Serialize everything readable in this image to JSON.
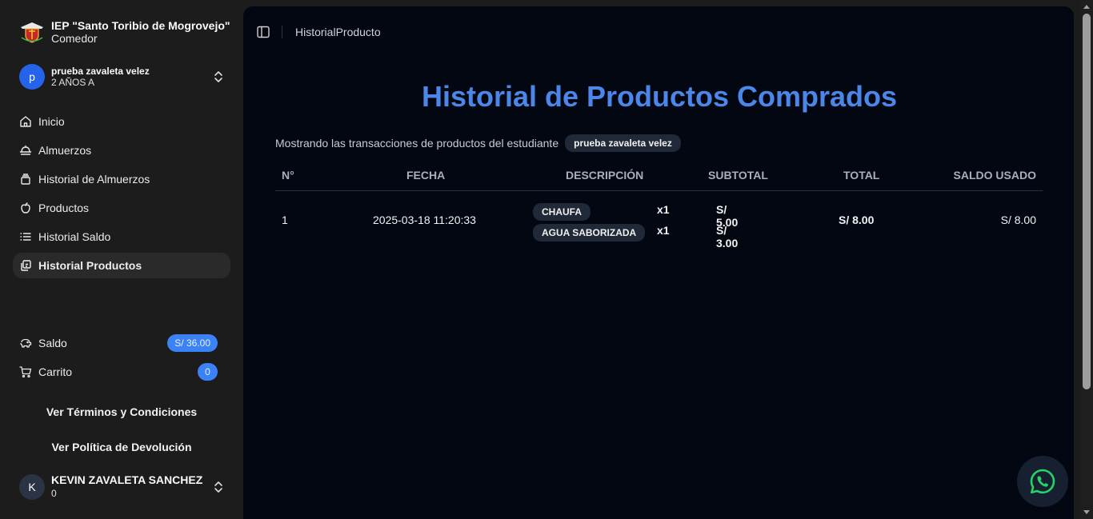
{
  "brand": {
    "title": "IEP \"Santo Toribio de Mogrovejo\"",
    "subtitle": "Comedor",
    "logo_icon": "school-crest-icon"
  },
  "student": {
    "avatar": "p",
    "name": "prueba zavaleta velez",
    "grade": "2 AÑOS A"
  },
  "nav": [
    {
      "label": "Inicio",
      "icon": "home-icon"
    },
    {
      "label": "Almuerzos",
      "icon": "lunch-icon"
    },
    {
      "label": "Historial de Almuerzos",
      "icon": "history-icon"
    },
    {
      "label": "Productos",
      "icon": "apple-icon"
    },
    {
      "label": "Historial Saldo",
      "icon": "list-icon"
    },
    {
      "label": "Historial Productos",
      "icon": "copy-icon",
      "active": true
    }
  ],
  "balance": {
    "label": "Saldo",
    "value": "S/ 36.00"
  },
  "cart": {
    "label": "Carrito",
    "count": "0"
  },
  "links": {
    "terms": "Ver Términos y Condiciones",
    "returns": "Ver Política de Devolución"
  },
  "user": {
    "avatar": "K",
    "name": "KEVIN ZAVALETA SANCHEZ",
    "sub": "0"
  },
  "breadcrumb": "HistorialProducto",
  "page": {
    "title": "Historial de Productos Comprados",
    "subtitle": "Mostrando las transacciones de productos del estudiante",
    "student_badge": "prueba zavaleta velez"
  },
  "table": {
    "headers": {
      "num": "N°",
      "date": "FECHA",
      "desc": "DESCRIPCIÓN",
      "subtotal": "SUBTOTAL",
      "total": "TOTAL",
      "used": "SALDO USADO"
    },
    "rows": [
      {
        "num": "1",
        "date": "2025-03-18 11:20:33",
        "items": [
          {
            "name": "CHAUFA",
            "qty": "x1",
            "subtotal": "S/ 5.00"
          },
          {
            "name": "AGUA SABORIZADA",
            "qty": "x1",
            "subtotal": "S/ 3.00"
          }
        ],
        "total": "S/ 8.00",
        "used": "S/ 8.00"
      }
    ]
  },
  "colors": {
    "accent": "#3b82f6",
    "title": "#4b86e8",
    "whatsapp": "#25d366",
    "main_bg": "#030712",
    "sidebar_bg": "#1c1c1c"
  },
  "fab_icon": "whatsapp-icon"
}
